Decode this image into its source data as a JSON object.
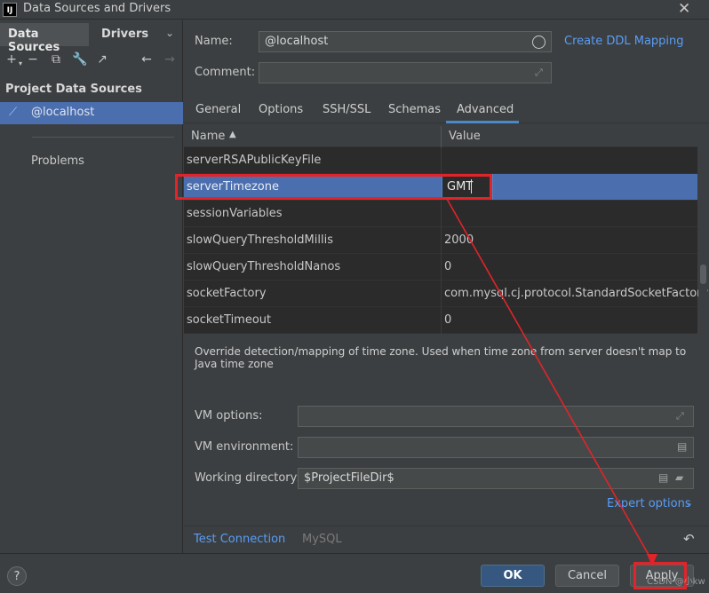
{
  "window": {
    "title": "Data Sources and Drivers",
    "app_icon_text": "IJ"
  },
  "left": {
    "tabs": [
      "Data Sources",
      "Drivers"
    ],
    "section_title": "Project Data Sources",
    "datasource": "@localhost",
    "problems": "Problems"
  },
  "form": {
    "name_label": "Name:",
    "name_value": "@localhost",
    "comment_label": "Comment:",
    "comment_value": "",
    "ddl_link": "Create DDL Mapping"
  },
  "tabs": [
    "General",
    "Options",
    "SSH/SSL",
    "Schemas",
    "Advanced"
  ],
  "active_tab": "Advanced",
  "table": {
    "col_name": "Name",
    "col_value": "Value",
    "rows": [
      {
        "name": "serverRSAPublicKeyFile",
        "value": ""
      },
      {
        "name": "serverTimezone",
        "value": "GMT"
      },
      {
        "name": "sessionVariables",
        "value": ""
      },
      {
        "name": "slowQueryThresholdMillis",
        "value": "2000"
      },
      {
        "name": "slowQueryThresholdNanos",
        "value": "0"
      },
      {
        "name": "socketFactory",
        "value": "com.mysql.cj.protocol.StandardSocketFactory"
      },
      {
        "name": "socketTimeout",
        "value": "0"
      }
    ]
  },
  "description": "Override detection/mapping of time zone. Used when time zone from server doesn't map to Java time zone",
  "vm": {
    "options_label": "VM options:",
    "env_label": "VM environment:",
    "workdir_label": "Working directory:",
    "workdir_value": "$ProjectFileDir$"
  },
  "expert_options": "Expert options",
  "bottom": {
    "test_connection": "Test Connection",
    "driver": "MySQL"
  },
  "buttons": {
    "help": "?",
    "ok": "OK",
    "cancel": "Cancel",
    "apply": "Apply"
  },
  "watermark": "CSDN @小kw",
  "colors": {
    "accent": "#4b6eaf",
    "link": "#589df6",
    "highlight": "#e0242a"
  }
}
